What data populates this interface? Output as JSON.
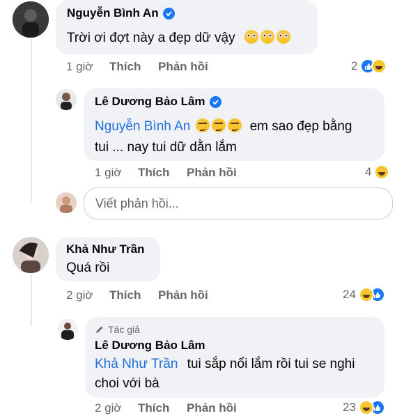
{
  "comments": [
    {
      "name": "Nguyễn Bình An",
      "verified": true,
      "text": "Trời ơi đợt này a đẹp dữ vậy",
      "emojis": [
        "pleading-face",
        "pleading-face",
        "pleading-face"
      ],
      "time": "1 giờ",
      "like": "Thích",
      "reply": "Phản hồi",
      "reaction_count": "2",
      "reactions": [
        "like",
        "haha"
      ]
    },
    {
      "name": "Lê Dương Bảo Lâm",
      "verified": true,
      "mention": "Nguyễn Bình An",
      "text_line1": "em sao đẹp bằng",
      "text_line2": "tui ... nay tui dữ dằn lắm",
      "emojis": [
        "smirking-face",
        "smirking-face",
        "smirking-face"
      ],
      "time": "1 giờ",
      "like": "Thích",
      "reply": "Phản hồi",
      "reaction_count": "4",
      "reactions": [
        "haha"
      ]
    },
    {
      "name": "Khả Như Trần",
      "text": "Quá rồi",
      "time": "2 giờ",
      "like": "Thích",
      "reply": "Phản hồi",
      "reaction_count": "24",
      "reactions": [
        "haha",
        "like"
      ]
    },
    {
      "author_tag": "Tác giả",
      "name": "Lê Dương Bảo Lâm",
      "mention": "Khả Như Trần",
      "text_line1": "tui sắp nổi lắm rồi tui se nghi",
      "text_line2": "choi với bà",
      "time": "2 giờ",
      "like": "Thích",
      "reply": "Phản hồi",
      "reaction_count": "23",
      "reactions": [
        "haha",
        "like"
      ]
    }
  ],
  "reply_input": {
    "placeholder": "Viết phản hồi..."
  },
  "colors": {
    "mention": "#216fdb",
    "bubble": "#f0f2f5",
    "meta": "#65676b",
    "verified": "#1877f2"
  }
}
